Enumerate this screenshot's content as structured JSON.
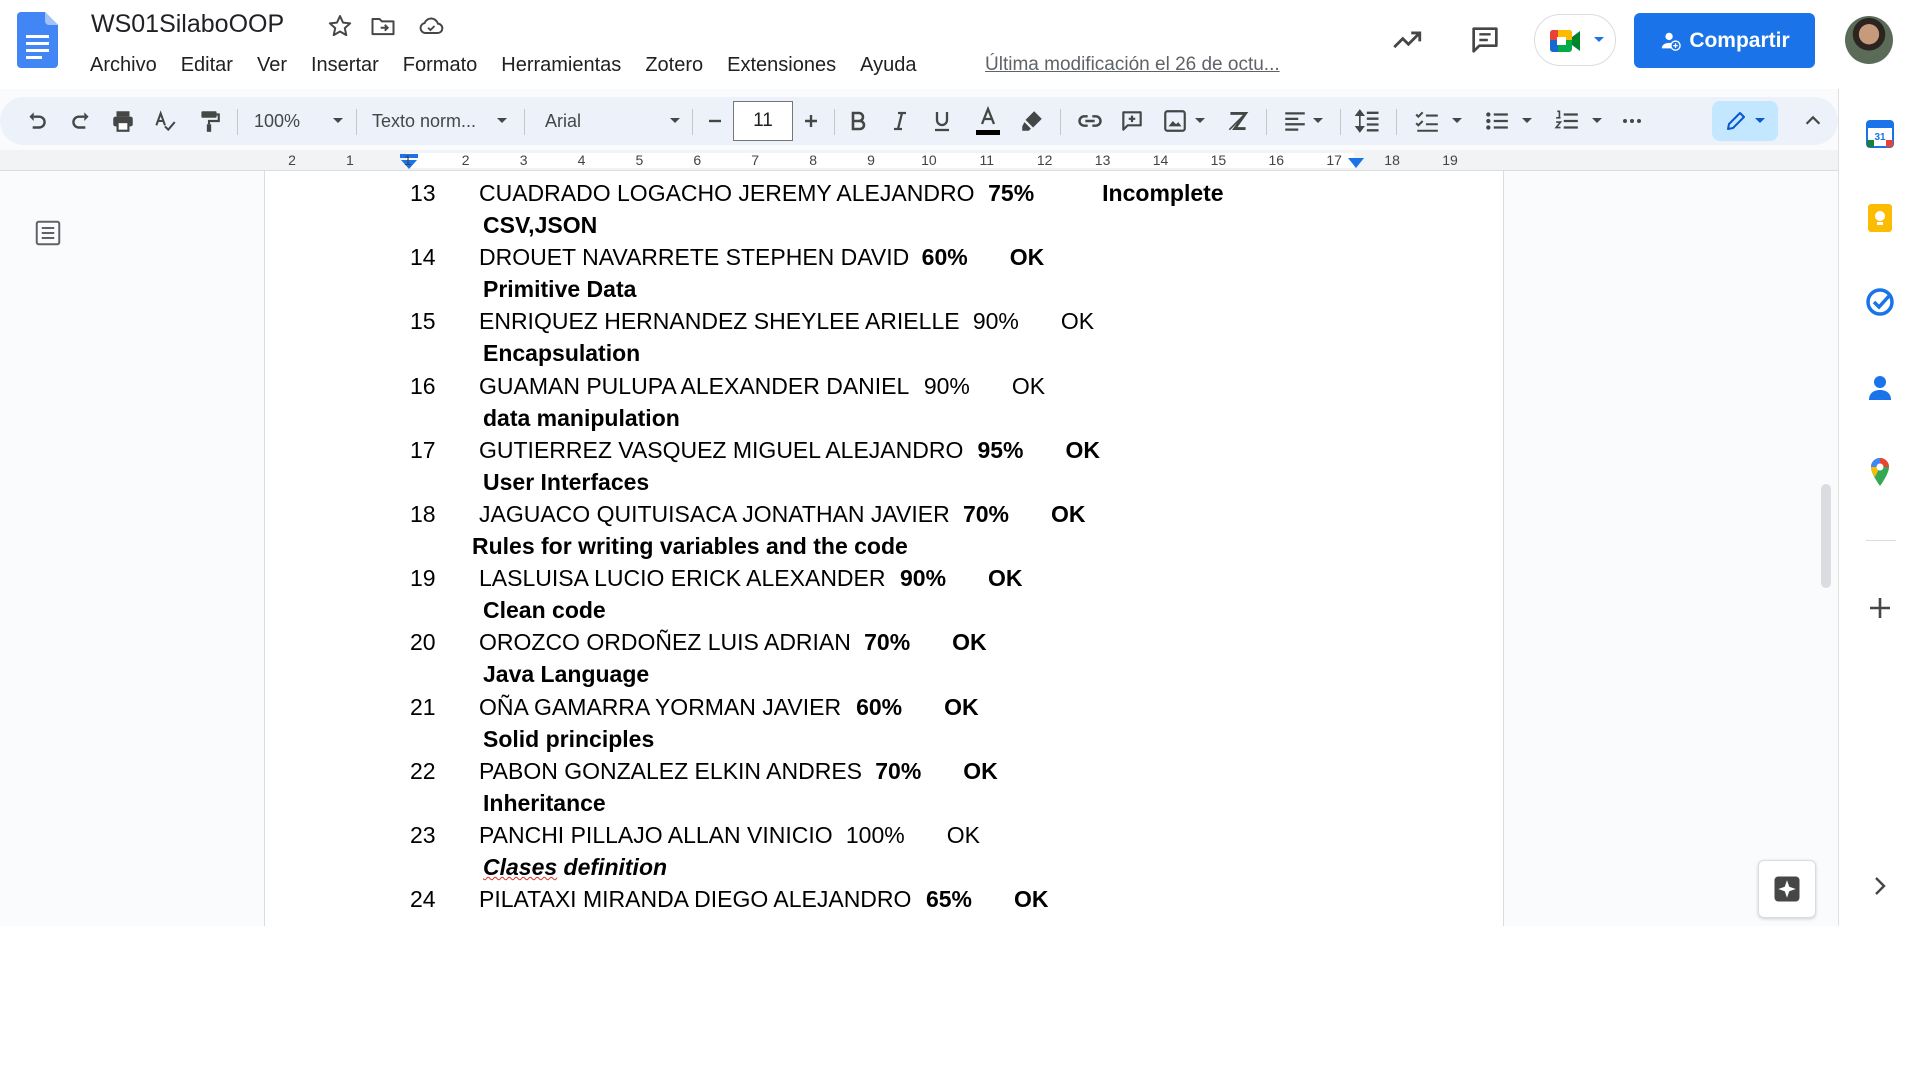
{
  "app": {
    "doc_title": "WS01SilaboOOP",
    "last_edit": "Última modificación el 26 de octu...",
    "share_label": "Compartir"
  },
  "menu": [
    "Archivo",
    "Editar",
    "Ver",
    "Insertar",
    "Formato",
    "Herramientas",
    "Zotero",
    "Extensiones",
    "Ayuda"
  ],
  "toolbar": {
    "zoom": "100%",
    "style": "Texto norm...",
    "font": "Arial",
    "font_size": "11"
  },
  "ruler": {
    "labels": [
      "2",
      "1",
      "1",
      "2",
      "3",
      "4",
      "5",
      "6",
      "7",
      "8",
      "9",
      "10",
      "11",
      "12",
      "13",
      "14",
      "15",
      "16",
      "17",
      "18",
      "19"
    ]
  },
  "document": {
    "rows": [
      {
        "num": "13",
        "name": "CUADRADO LOGACHO JEREMY ALEJANDRO",
        "pct": "75%",
        "pct_bold": true,
        "status": "Incomplete",
        "status_bold": true,
        "topic": "CSV,JSON"
      },
      {
        "num": "14",
        "name": "DROUET NAVARRETE STEPHEN DAVID",
        "pct": "60%",
        "pct_bold": true,
        "status": "OK",
        "status_bold": true,
        "topic": "Primitive Data"
      },
      {
        "num": "15",
        "name": "ENRIQUEZ HERNANDEZ SHEYLEE ARIELLE",
        "pct": "90%",
        "pct_bold": false,
        "status": "OK",
        "status_bold": false,
        "topic": "Encapsulation"
      },
      {
        "num": "16",
        "name": "GUAMAN PULUPA ALEXANDER DANIEL",
        "pct": "90%",
        "pct_bold": false,
        "status": "OK",
        "status_bold": false,
        "topic": "data manipulation"
      },
      {
        "num": "17",
        "name": "GUTIERREZ VASQUEZ MIGUEL ALEJANDRO",
        "pct": "95%",
        "pct_bold": true,
        "status": "OK",
        "status_bold": true,
        "topic": "User Interfaces"
      },
      {
        "num": "18",
        "name": "JAGUACO QUITUISACA JONATHAN JAVIER",
        "pct": "70%",
        "pct_bold": true,
        "status": "OK",
        "status_bold": true,
        "topic": "Rules for writing variables and the code"
      },
      {
        "num": "19",
        "name": "LASLUISA LUCIO ERICK ALEXANDER",
        "pct": "90%",
        "pct_bold": true,
        "status": "OK",
        "status_bold": true,
        "topic": "Clean code"
      },
      {
        "num": "20",
        "name": "OROZCO ORDOÑEZ LUIS ADRIAN",
        "pct": "70%",
        "pct_bold": true,
        "status": "OK",
        "status_bold": true,
        "topic": "Java Language"
      },
      {
        "num": "21",
        "name": "OÑA GAMARRA YORMAN JAVIER",
        "pct": "60%",
        "pct_bold": true,
        "status": "OK",
        "status_bold": true,
        "topic": "Solid principles"
      },
      {
        "num": "22",
        "name": "PABON GONZALEZ ELKIN ANDRES",
        "pct": "70%",
        "pct_bold": true,
        "status": "OK",
        "status_bold": true,
        "topic": "Inheritance"
      },
      {
        "num": "23",
        "name": "PANCHI PILLAJO ALLAN VINICIO",
        "pct": "100%",
        "pct_bold": false,
        "status": "OK",
        "status_bold": false,
        "topic_first": "Clases",
        "topic_rest": " definition"
      },
      {
        "num": "24",
        "name": "PILATAXI MIRANDA DIEGO ALEJANDRO",
        "pct": "65%",
        "pct_bold": true,
        "status": "OK",
        "status_bold": true
      }
    ]
  },
  "colors": {
    "share_blue": "#1a73e8",
    "toolbar_bg": "#edf2fa",
    "docs_blue": "#4285f4"
  },
  "icons": {
    "header": [
      "star-icon",
      "move-to-folder-icon",
      "cloud-saved-icon",
      "activity-trend-icon",
      "comments-icon",
      "google-meet-icon",
      "person-add-icon"
    ],
    "side": [
      "calendar-icon",
      "keep-icon",
      "tasks-icon",
      "contacts-icon",
      "maps-icon",
      "add-icon",
      "chevron-right-icon"
    ]
  }
}
